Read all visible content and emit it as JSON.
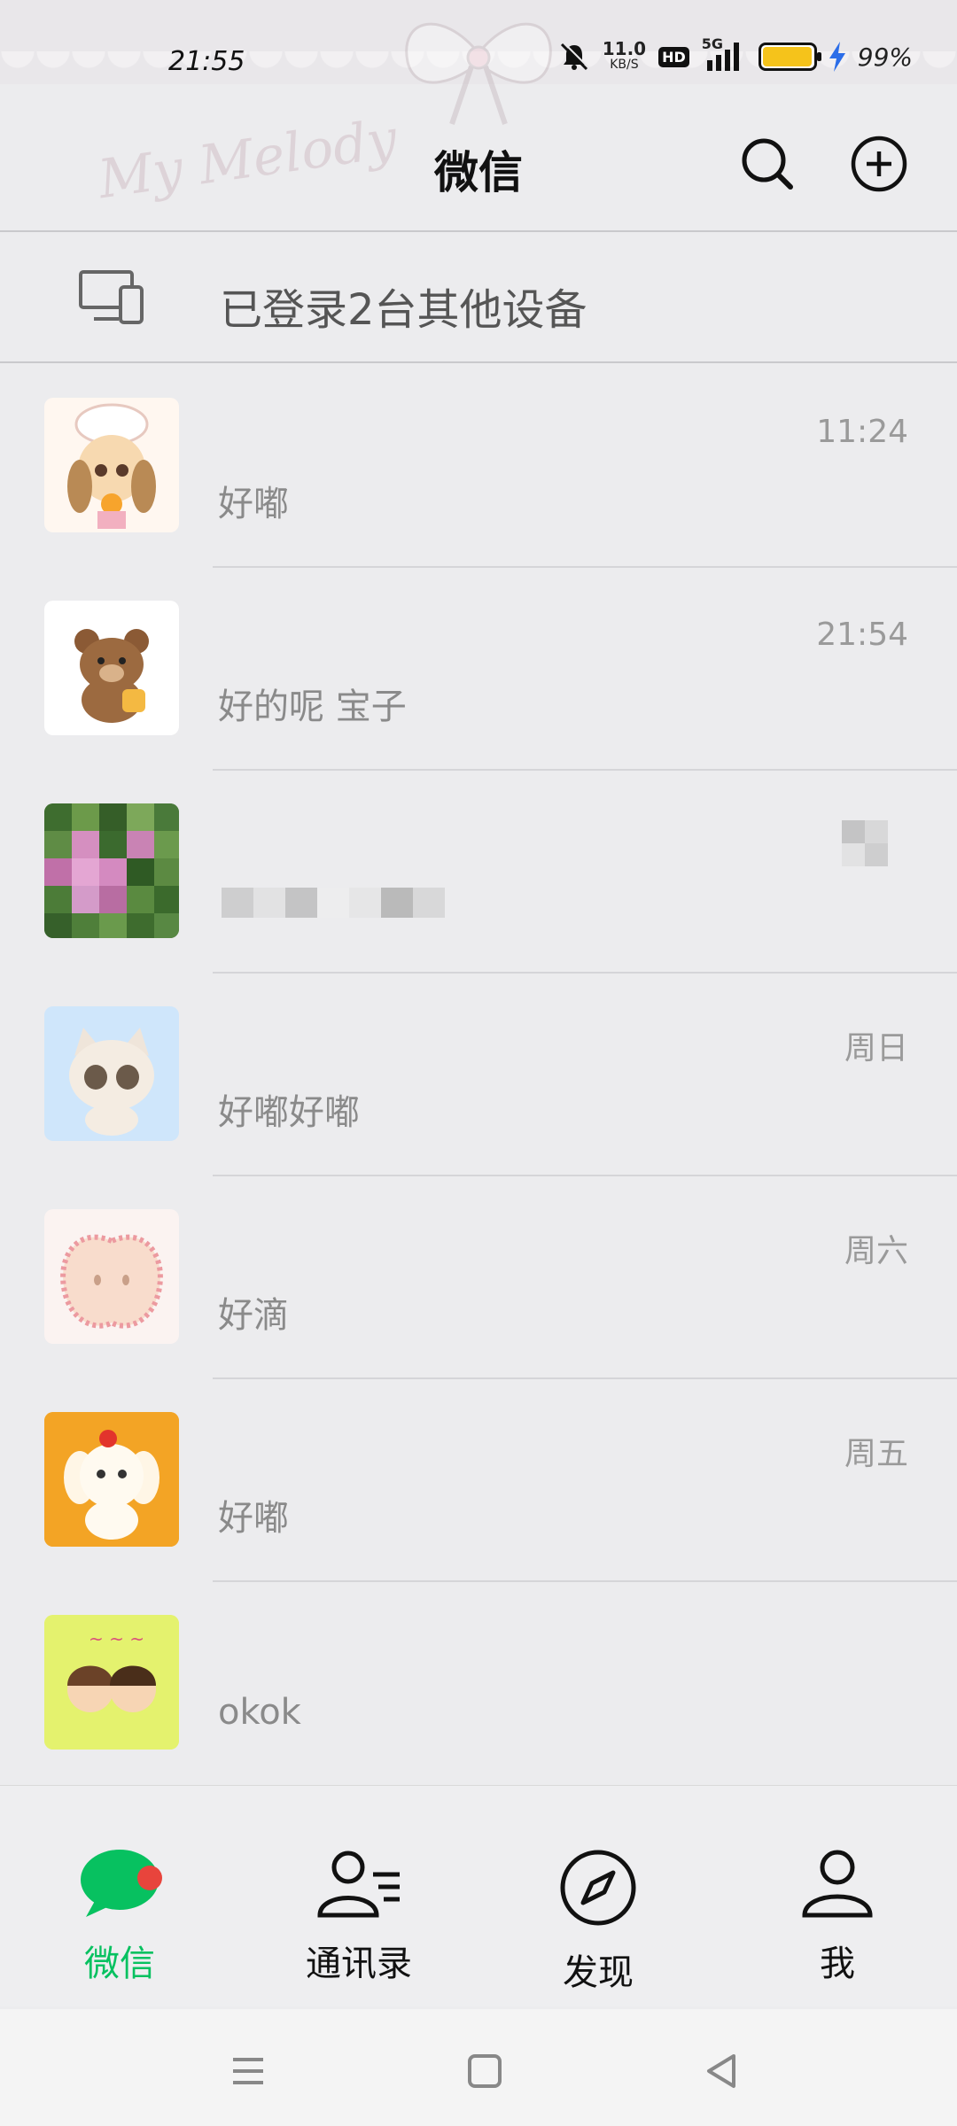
{
  "status_bar": {
    "time": "21:55",
    "net_speed": "11.0",
    "net_unit": "KB/S",
    "hd": "HD",
    "signal": "5G",
    "battery_pct": "99%",
    "battery_level": 0.99,
    "battery_color": "#f5c31b"
  },
  "header": {
    "watermark": "My Melody",
    "title": "微信",
    "search_icon": "search-icon",
    "add_icon": "plus-circle-icon"
  },
  "devices_bar": {
    "icon": "devices-icon",
    "label": "已登录2台其他设备"
  },
  "chats": [
    {
      "name": "…",
      "preview": "好嘟",
      "time": "11:24",
      "avatar": "anime-girl-chef"
    },
    {
      "name": "",
      "preview": "好的呢 宝子",
      "time": "21:54",
      "avatar": "brown-bear-honey"
    },
    {
      "name": "",
      "preview": "",
      "time": "",
      "avatar": "pink-flower-pixelated"
    },
    {
      "name": "",
      "preview": "好嘟好嘟",
      "time": "周日",
      "avatar": "white-cat-blue"
    },
    {
      "name": "",
      "preview": "好滴",
      "time": "周六",
      "avatar": "pink-apple"
    },
    {
      "name": "",
      "preview": "好嘟",
      "time": "周五",
      "avatar": "puppy-orange"
    },
    {
      "name": "",
      "preview": "okok",
      "time": "",
      "avatar": "couple-chibi-yellow"
    }
  ],
  "tabs": [
    {
      "label": "微信",
      "icon": "chat-bubble-icon",
      "active": true,
      "badge": true
    },
    {
      "label": "通讯录",
      "icon": "contacts-icon",
      "active": false
    },
    {
      "label": "发现",
      "icon": "compass-icon",
      "active": false
    },
    {
      "label": "我",
      "icon": "person-icon",
      "active": false
    }
  ],
  "colors": {
    "accent": "#07c160",
    "badge": "#e8443c",
    "background": "#ececee"
  }
}
